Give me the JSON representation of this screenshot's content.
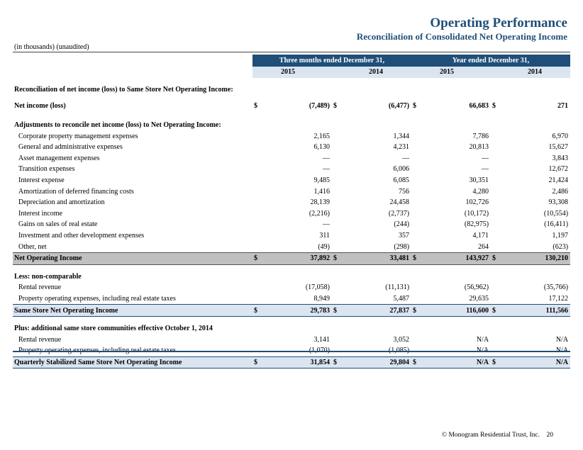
{
  "header": {
    "title": "Operating Performance",
    "subtitle": "Reconciliation of Consolidated Net Operating Income",
    "units": "(in thousands) (unaudited)"
  },
  "columns": {
    "group_three_months": "Three months ended December 31,",
    "group_year": "Year ended December 31,",
    "years": [
      "2015",
      "2014",
      "2015",
      "2014"
    ]
  },
  "sections": {
    "recon_heading": "Reconciliation of net income (loss) to Same Store Net Operating Income:",
    "adjustments_heading": "Adjustments to reconcile net income (loss) to Net Operating Income:",
    "less_heading": "Less:  non-comparable",
    "plus_heading": "Plus:  additional same store communities effective October 1, 2014"
  },
  "rows": {
    "net_income": {
      "label": "Net income (loss)",
      "values": [
        "(7,489)",
        "(6,477)",
        "66,683",
        "271"
      ]
    },
    "adjustments": [
      {
        "label": "Corporate property management expenses",
        "values": [
          "2,165",
          "1,344",
          "7,786",
          "6,970"
        ]
      },
      {
        "label": "General and administrative expenses",
        "values": [
          "6,130",
          "4,231",
          "20,813",
          "15,627"
        ]
      },
      {
        "label": "Asset management expenses",
        "values": [
          "—",
          "—",
          "—",
          "3,843"
        ]
      },
      {
        "label": "Transition expenses",
        "values": [
          "—",
          "6,006",
          "—",
          "12,672"
        ]
      },
      {
        "label": "Interest expense",
        "values": [
          "9,485",
          "6,085",
          "30,351",
          "21,424"
        ]
      },
      {
        "label": "Amortization of deferred financing costs",
        "values": [
          "1,416",
          "756",
          "4,280",
          "2,486"
        ]
      },
      {
        "label": "Depreciation and amortization",
        "values": [
          "28,139",
          "24,458",
          "102,726",
          "93,308"
        ]
      },
      {
        "label": "Interest income",
        "values": [
          "(2,216)",
          "(2,737)",
          "(10,172)",
          "(10,554)"
        ]
      },
      {
        "label": "Gains on sales of real estate",
        "values": [
          "—",
          "(244)",
          "(82,975)",
          "(16,411)"
        ]
      },
      {
        "label": "Investment and other development expenses",
        "values": [
          "311",
          "357",
          "4,171",
          "1,197"
        ]
      },
      {
        "label": "Other, net",
        "values": [
          "(49)",
          "(298)",
          "264",
          "(623)"
        ]
      }
    ],
    "noi": {
      "label": "Net Operating Income",
      "values": [
        "37,892",
        "33,481",
        "143,927",
        "130,210"
      ]
    },
    "less": [
      {
        "label": "Rental revenue",
        "values": [
          "(17,058)",
          "(11,131)",
          "(56,962)",
          "(35,766)"
        ]
      },
      {
        "label": "Property operating expenses, including real estate taxes",
        "values": [
          "8,949",
          "5,487",
          "29,635",
          "17,122"
        ]
      }
    ],
    "ss_noi": {
      "label": "Same Store Net Operating Income",
      "values": [
        "29,783",
        "27,837",
        "116,600",
        "111,566"
      ]
    },
    "plus": [
      {
        "label": "Rental revenue",
        "values": [
          "3,141",
          "3,052",
          "N/A",
          "N/A"
        ]
      },
      {
        "label": "Property operating expenses, including real estate taxes",
        "values": [
          "(1,070)",
          "(1,085)",
          "N/A",
          "N/A"
        ]
      }
    ],
    "qs_noi": {
      "label": "Quarterly Stabilized Same Store Net Operating Income",
      "values": [
        "31,854",
        "29,804",
        "N/A",
        "N/A"
      ]
    }
  },
  "currency_symbol": "$",
  "footer": {
    "text": "© Monogram Residential Trust, Inc.",
    "page": "20"
  }
}
